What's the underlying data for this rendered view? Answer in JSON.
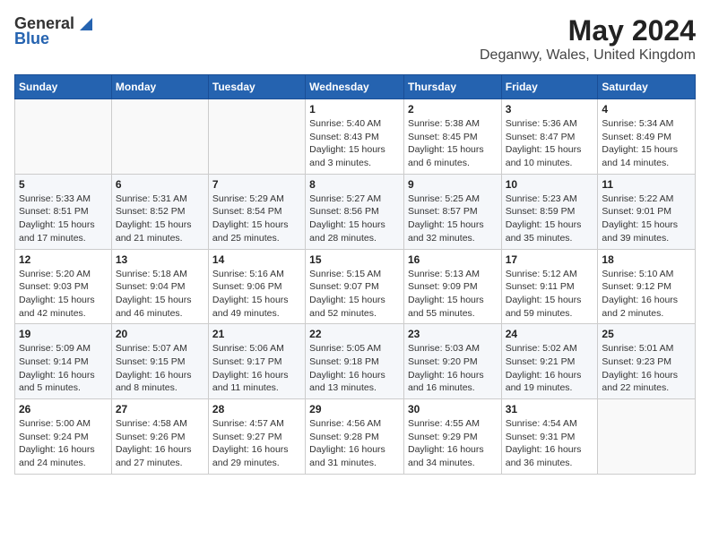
{
  "header": {
    "logo_general": "General",
    "logo_blue": "Blue",
    "month_year": "May 2024",
    "location": "Deganwy, Wales, United Kingdom"
  },
  "calendar": {
    "days_of_week": [
      "Sunday",
      "Monday",
      "Tuesday",
      "Wednesday",
      "Thursday",
      "Friday",
      "Saturday"
    ],
    "weeks": [
      [
        {
          "day": "",
          "info": ""
        },
        {
          "day": "",
          "info": ""
        },
        {
          "day": "",
          "info": ""
        },
        {
          "day": "1",
          "info": "Sunrise: 5:40 AM\nSunset: 8:43 PM\nDaylight: 15 hours\nand 3 minutes."
        },
        {
          "day": "2",
          "info": "Sunrise: 5:38 AM\nSunset: 8:45 PM\nDaylight: 15 hours\nand 6 minutes."
        },
        {
          "day": "3",
          "info": "Sunrise: 5:36 AM\nSunset: 8:47 PM\nDaylight: 15 hours\nand 10 minutes."
        },
        {
          "day": "4",
          "info": "Sunrise: 5:34 AM\nSunset: 8:49 PM\nDaylight: 15 hours\nand 14 minutes."
        }
      ],
      [
        {
          "day": "5",
          "info": "Sunrise: 5:33 AM\nSunset: 8:51 PM\nDaylight: 15 hours\nand 17 minutes."
        },
        {
          "day": "6",
          "info": "Sunrise: 5:31 AM\nSunset: 8:52 PM\nDaylight: 15 hours\nand 21 minutes."
        },
        {
          "day": "7",
          "info": "Sunrise: 5:29 AM\nSunset: 8:54 PM\nDaylight: 15 hours\nand 25 minutes."
        },
        {
          "day": "8",
          "info": "Sunrise: 5:27 AM\nSunset: 8:56 PM\nDaylight: 15 hours\nand 28 minutes."
        },
        {
          "day": "9",
          "info": "Sunrise: 5:25 AM\nSunset: 8:57 PM\nDaylight: 15 hours\nand 32 minutes."
        },
        {
          "day": "10",
          "info": "Sunrise: 5:23 AM\nSunset: 8:59 PM\nDaylight: 15 hours\nand 35 minutes."
        },
        {
          "day": "11",
          "info": "Sunrise: 5:22 AM\nSunset: 9:01 PM\nDaylight: 15 hours\nand 39 minutes."
        }
      ],
      [
        {
          "day": "12",
          "info": "Sunrise: 5:20 AM\nSunset: 9:03 PM\nDaylight: 15 hours\nand 42 minutes."
        },
        {
          "day": "13",
          "info": "Sunrise: 5:18 AM\nSunset: 9:04 PM\nDaylight: 15 hours\nand 46 minutes."
        },
        {
          "day": "14",
          "info": "Sunrise: 5:16 AM\nSunset: 9:06 PM\nDaylight: 15 hours\nand 49 minutes."
        },
        {
          "day": "15",
          "info": "Sunrise: 5:15 AM\nSunset: 9:07 PM\nDaylight: 15 hours\nand 52 minutes."
        },
        {
          "day": "16",
          "info": "Sunrise: 5:13 AM\nSunset: 9:09 PM\nDaylight: 15 hours\nand 55 minutes."
        },
        {
          "day": "17",
          "info": "Sunrise: 5:12 AM\nSunset: 9:11 PM\nDaylight: 15 hours\nand 59 minutes."
        },
        {
          "day": "18",
          "info": "Sunrise: 5:10 AM\nSunset: 9:12 PM\nDaylight: 16 hours\nand 2 minutes."
        }
      ],
      [
        {
          "day": "19",
          "info": "Sunrise: 5:09 AM\nSunset: 9:14 PM\nDaylight: 16 hours\nand 5 minutes."
        },
        {
          "day": "20",
          "info": "Sunrise: 5:07 AM\nSunset: 9:15 PM\nDaylight: 16 hours\nand 8 minutes."
        },
        {
          "day": "21",
          "info": "Sunrise: 5:06 AM\nSunset: 9:17 PM\nDaylight: 16 hours\nand 11 minutes."
        },
        {
          "day": "22",
          "info": "Sunrise: 5:05 AM\nSunset: 9:18 PM\nDaylight: 16 hours\nand 13 minutes."
        },
        {
          "day": "23",
          "info": "Sunrise: 5:03 AM\nSunset: 9:20 PM\nDaylight: 16 hours\nand 16 minutes."
        },
        {
          "day": "24",
          "info": "Sunrise: 5:02 AM\nSunset: 9:21 PM\nDaylight: 16 hours\nand 19 minutes."
        },
        {
          "day": "25",
          "info": "Sunrise: 5:01 AM\nSunset: 9:23 PM\nDaylight: 16 hours\nand 22 minutes."
        }
      ],
      [
        {
          "day": "26",
          "info": "Sunrise: 5:00 AM\nSunset: 9:24 PM\nDaylight: 16 hours\nand 24 minutes."
        },
        {
          "day": "27",
          "info": "Sunrise: 4:58 AM\nSunset: 9:26 PM\nDaylight: 16 hours\nand 27 minutes."
        },
        {
          "day": "28",
          "info": "Sunrise: 4:57 AM\nSunset: 9:27 PM\nDaylight: 16 hours\nand 29 minutes."
        },
        {
          "day": "29",
          "info": "Sunrise: 4:56 AM\nSunset: 9:28 PM\nDaylight: 16 hours\nand 31 minutes."
        },
        {
          "day": "30",
          "info": "Sunrise: 4:55 AM\nSunset: 9:29 PM\nDaylight: 16 hours\nand 34 minutes."
        },
        {
          "day": "31",
          "info": "Sunrise: 4:54 AM\nSunset: 9:31 PM\nDaylight: 16 hours\nand 36 minutes."
        },
        {
          "day": "",
          "info": ""
        }
      ]
    ]
  }
}
